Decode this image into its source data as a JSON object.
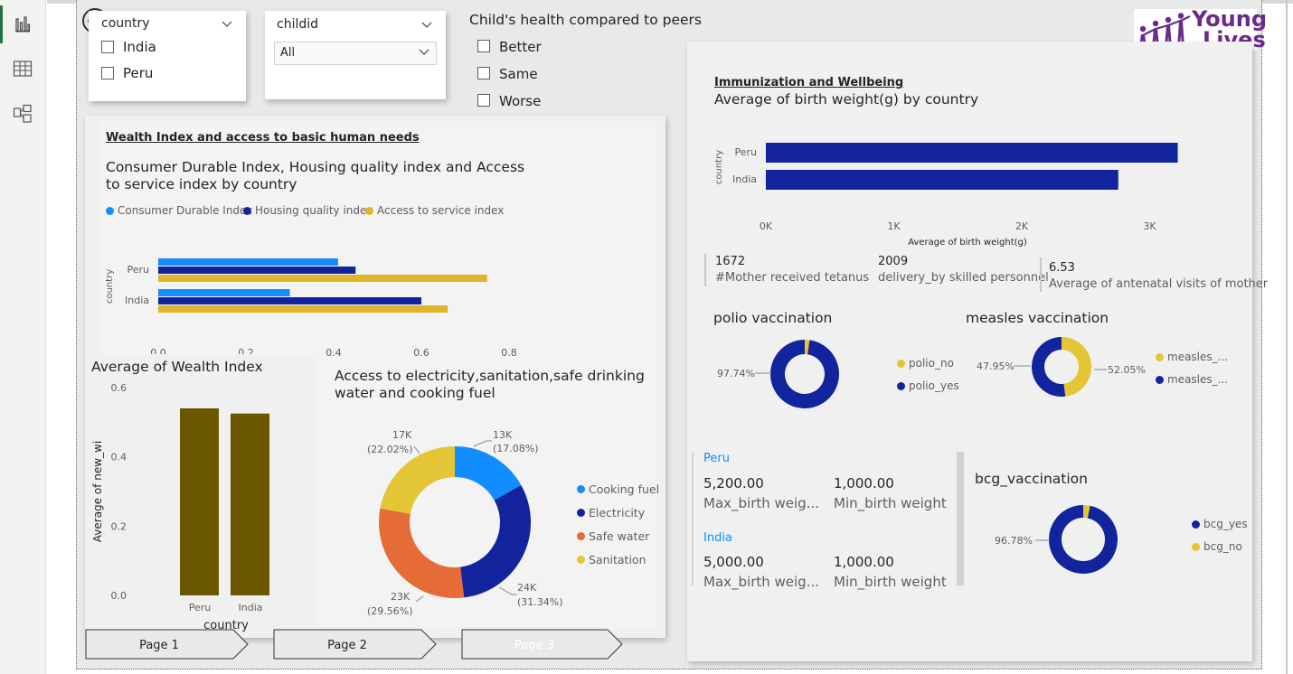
{
  "slicers": {
    "country": {
      "title": "country",
      "items": [
        "India",
        "Peru"
      ]
    },
    "childid": {
      "title": "childid",
      "selected": "All"
    },
    "health": {
      "title": "Child's health compared to peers",
      "items": [
        "Better",
        "Same",
        "Worse"
      ]
    }
  },
  "logo": {
    "line1": "Young",
    "line2": "Lives"
  },
  "wealth": {
    "section_title": "Wealth Index and access to basic human needs",
    "chart_title_line1": "Consumer Durable Index, Housing quality index and Access",
    "chart_title_line2": "to service index by country",
    "legend": [
      "Consumer Durable Index",
      "Housing quality index",
      "Access to service index"
    ]
  },
  "avg_wealth": {
    "title": "Average of Wealth Index",
    "ylabel": "Average of new_wi",
    "xlabel": "country"
  },
  "access": {
    "title_line1": "Access to electricity,sanitation,safe drinking",
    "title_line2": "water and cooking fuel",
    "legend": [
      "Cooking fuel",
      "Electricity",
      "Safe water",
      "Sanitation"
    ],
    "labels": [
      {
        "value": "13K",
        "pct": "(17.08%)"
      },
      {
        "value": "24K",
        "pct": "(31.34%)"
      },
      {
        "value": "23K",
        "pct": "(29.56%)"
      },
      {
        "value": "17K",
        "pct": "(22.02%)"
      }
    ]
  },
  "immun": {
    "section_title": "Immunization and Wellbeing",
    "chart_title": "Average of birth weight(g) by country",
    "xlabel": "Average of birth weight(g)",
    "ylabel": "country"
  },
  "kpis": [
    {
      "value": "1672",
      "label": "#Mother received tetanus"
    },
    {
      "value": "2009",
      "label": "delivery_by skilled personnel"
    },
    {
      "value": "6.53",
      "label": "Average of antenatal visits of mother"
    }
  ],
  "polio": {
    "title": "polio vaccination",
    "label_yes": "97.74%",
    "legend": [
      "polio_no",
      "polio_yes"
    ]
  },
  "measles": {
    "title": "measles vaccination",
    "label_left": "47.95%",
    "label_right": "52.05%",
    "legend": [
      "measles_...",
      "measles_..."
    ]
  },
  "bcg": {
    "title": "bcg_vaccination",
    "label_yes": "96.78%",
    "legend": [
      "bcg_yes",
      "bcg_no"
    ]
  },
  "birth_cards": [
    {
      "country": "Peru",
      "max_value": "5,200.00",
      "max_label": "Max_birth weig...",
      "min_value": "1,000.00",
      "min_label": "Min_birth weight"
    },
    {
      "country": "India",
      "max_value": "5,000.00",
      "max_label": "Max_birth weig...",
      "min_value": "1,000.00",
      "min_label": "Min_birth weight"
    }
  ],
  "nav": [
    "Page 1",
    "Page 2",
    "Page 3"
  ],
  "colors": {
    "light_blue": "#118dff",
    "dark_blue": "#12239e",
    "gold": "#e0b628",
    "orange": "#e66c37",
    "olive": "#6b5600",
    "sanitation_yellow": "#e3c535"
  },
  "chart_data": [
    {
      "type": "bar",
      "orientation": "horizontal",
      "categories": [
        "Peru",
        "India"
      ],
      "series": [
        {
          "name": "Consumer Durable Index",
          "values": [
            0.41,
            0.3
          ]
        },
        {
          "name": "Housing quality index",
          "values": [
            0.45,
            0.6
          ]
        },
        {
          "name": "Access to service index",
          "values": [
            0.75,
            0.66
          ]
        }
      ],
      "ylabel": "country",
      "xlim": [
        0,
        0.8
      ],
      "xticks": [
        "0.0",
        "0.2",
        "0.4",
        "0.6",
        "0.8"
      ]
    },
    {
      "type": "bar",
      "title": "Average of Wealth Index",
      "categories": [
        "Peru",
        "India"
      ],
      "values": [
        0.54,
        0.525
      ],
      "xlabel": "country",
      "ylabel": "Average of new_wi",
      "ylim": [
        0,
        0.6
      ],
      "yticks": [
        "0.0",
        "0.2",
        "0.4",
        "0.6"
      ]
    },
    {
      "type": "pie",
      "donut": true,
      "categories": [
        "Cooking fuel",
        "Electricity",
        "Safe water",
        "Sanitation"
      ],
      "values": [
        13,
        24,
        23,
        17
      ],
      "percents": [
        17.08,
        31.34,
        29.56,
        22.02
      ]
    },
    {
      "type": "bar",
      "orientation": "horizontal",
      "title": "Average of birth weight(g) by country",
      "categories": [
        "Peru",
        "India"
      ],
      "values": [
        3220,
        2755
      ],
      "xlim": [
        0,
        3400
      ],
      "xticks": [
        "0K",
        "1K",
        "2K",
        "3K"
      ],
      "xlabel": "Average of birth weight(g)",
      "ylabel": "country"
    },
    {
      "type": "pie",
      "donut": true,
      "title": "polio vaccination",
      "categories": [
        "polio_no",
        "polio_yes"
      ],
      "percents": [
        2.26,
        97.74
      ]
    },
    {
      "type": "pie",
      "donut": true,
      "title": "measles vaccination",
      "categories": [
        "measles_...",
        "measles_..."
      ],
      "percents": [
        47.95,
        52.05
      ]
    },
    {
      "type": "pie",
      "donut": true,
      "title": "bcg_vaccination",
      "categories": [
        "bcg_no",
        "bcg_yes"
      ],
      "percents": [
        3.22,
        96.78
      ]
    }
  ]
}
